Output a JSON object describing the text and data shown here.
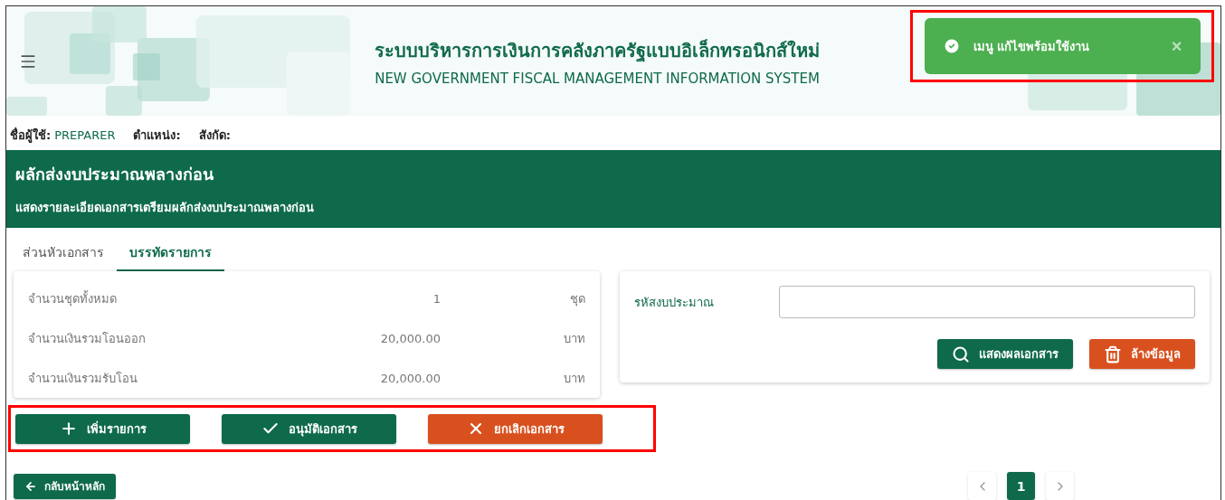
{
  "header": {
    "title_th": "ระบบบริหารการเงินการคลังภาครัฐแบบอิเล็กทรอนิกส์ใหม่",
    "title_en": "NEW GOVERNMENT FISCAL MANAGEMENT INFORMATION SYSTEM"
  },
  "toast": {
    "message": "เมนู แก้ไขพร้อมใช้งาน",
    "close": "×",
    "highlighted": true
  },
  "user_bar": [
    {
      "label": "ชื่อผู้ใช้:",
      "value": "PREPARER"
    },
    {
      "label": "ตำแหน่ง:"
    },
    {
      "label": "สังกัด:"
    }
  ],
  "banner": {
    "title": "ผลักส่งงบประมาณพลางก่อน",
    "subtitle": "แสดงรายละเอียดเอกสารเตรียมผลักส่งงบประมาณพลางก่อน"
  },
  "tabs": [
    {
      "label": "ส่วนหัวเอกสาร",
      "selected": false
    },
    {
      "label": "บรรทัดรายการ",
      "selected": true
    }
  ],
  "summary": [
    {
      "label": "จำนวนชุดทั้งหมด",
      "value": "1",
      "unit": "ชุด"
    },
    {
      "label": "จำนวนเงินรวมโอนออก",
      "value": "20,000.00",
      "unit": "บาท"
    },
    {
      "label": "จำนวนเงินรวมรับโอน",
      "value": "20,000.00",
      "unit": "บาท"
    }
  ],
  "search": {
    "label": "รหัสงบประมาณ",
    "buttons": [
      {
        "label": "แสดงผลเอกสาร",
        "kind": "search"
      },
      {
        "label": "ล้างข้อมูล",
        "kind": "clear"
      }
    ]
  },
  "actions": {
    "highlighted": true,
    "buttons": [
      {
        "label": "เพิ่มรายการ",
        "kind": "add"
      },
      {
        "label": "อนุมัติเอกสาร",
        "kind": "approve"
      },
      {
        "label": "ยกเลิกเอกสาร",
        "kind": "cancel"
      }
    ]
  },
  "back_button": "กลับหน้าหลัก",
  "pagination": {
    "pages": [
      {
        "label": "1",
        "selected": true
      }
    ]
  }
}
